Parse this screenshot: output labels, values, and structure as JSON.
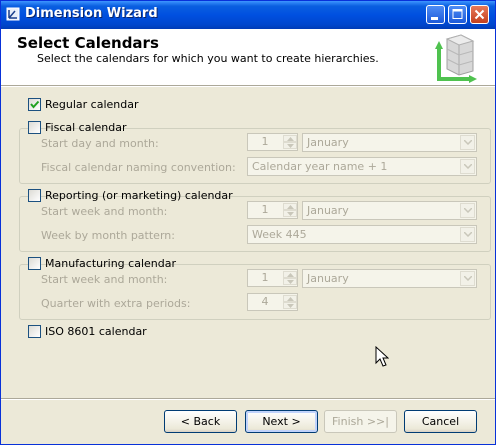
{
  "window": {
    "title": "Dimension Wizard"
  },
  "header": {
    "title": "Select Calendars",
    "subtitle": "Select the calendars for which you want to create hierarchies."
  },
  "regular": {
    "label": "Regular calendar",
    "checked": true
  },
  "fiscal": {
    "label": "Fiscal calendar",
    "start_label": "Start day and month:",
    "start_day": "1",
    "start_month": "January",
    "naming_label": "Fiscal calendar naming convention:",
    "naming_value": "Calendar year name + 1"
  },
  "reporting": {
    "label": "Reporting (or marketing) calendar",
    "start_label": "Start week and month:",
    "start_week": "1",
    "start_month": "January",
    "pattern_label": "Week by month pattern:",
    "pattern_value": "Week 445"
  },
  "manufacturing": {
    "label": "Manufacturing calendar",
    "start_label": "Start week and month:",
    "start_week": "1",
    "start_month": "January",
    "quarter_label": "Quarter with extra periods:",
    "quarter_value": "4"
  },
  "iso": {
    "label": "ISO 8601 calendar"
  },
  "buttons": {
    "back": "< Back",
    "next": "Next >",
    "finish": "Finish >>|",
    "cancel": "Cancel"
  }
}
